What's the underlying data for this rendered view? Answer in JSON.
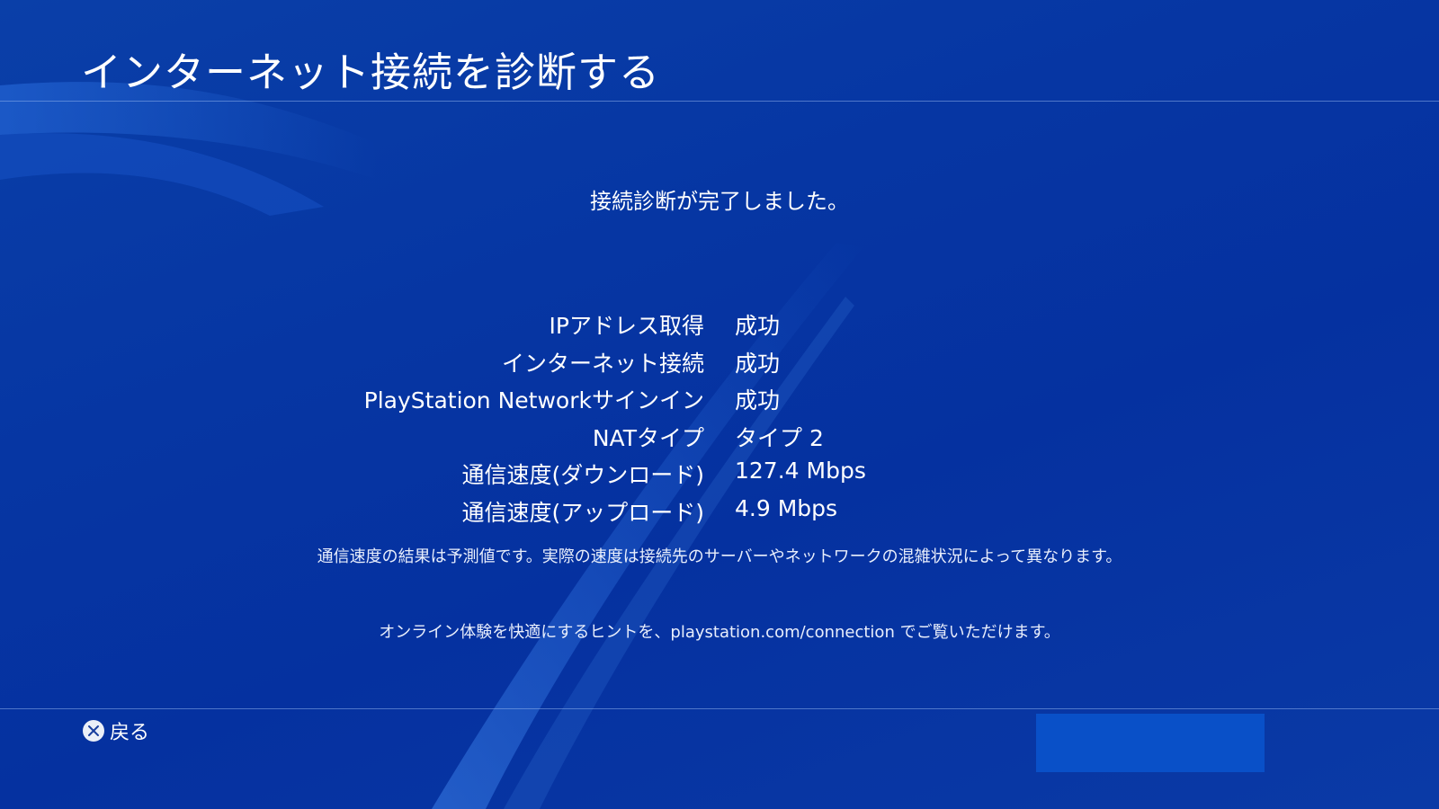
{
  "header": {
    "title": "インターネット接続を診断する"
  },
  "status": {
    "message": "接続診断が完了しました。"
  },
  "results": [
    {
      "label": "IPアドレス取得",
      "value": "成功"
    },
    {
      "label": "インターネット接続",
      "value": "成功"
    },
    {
      "label": "PlayStation Networkサインイン",
      "value": "成功"
    },
    {
      "label": "NATタイプ",
      "value": "タイプ 2"
    },
    {
      "label": "通信速度(ダウンロード)",
      "value": "127.4 Mbps"
    },
    {
      "label": "通信速度(アップロード)",
      "value": "4.9 Mbps"
    }
  ],
  "notes": {
    "speed_disclaimer": "通信速度の結果は予測値です。実際の速度は接続先のサーバーやネットワークの混雑状況によって異なります。",
    "hint": "オンライン体験を快適にするヒントを、playstation.com/connection でご覧いただけます。"
  },
  "footer": {
    "back_label": "戻る",
    "back_icon": "cross-button-icon"
  },
  "colors": {
    "background": "#0636a3",
    "divider": "#8cafeb",
    "panel": "#0950c8",
    "text": "#ffffff"
  }
}
